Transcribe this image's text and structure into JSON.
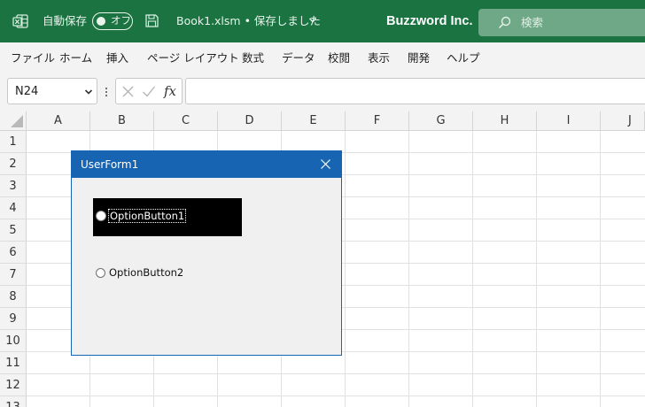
{
  "titlebar": {
    "autosave_label": "自動保存",
    "autosave_state": "オフ",
    "filename": "Book1.xlsm • 保存しました",
    "company": "Buzzword Inc.",
    "search_placeholder": "検索",
    "icons": [
      "excel-icon",
      "save-icon",
      "chevron-down-icon",
      "search-icon"
    ]
  },
  "menu": {
    "items": [
      "ファイル",
      "ホーム",
      "挿入",
      "ページ レイアウト",
      "数式",
      "データ",
      "校閲",
      "表示",
      "開発",
      "ヘルプ"
    ]
  },
  "formula_bar": {
    "name_box": "N24",
    "fx_label": "fx",
    "formula": ""
  },
  "grid": {
    "columns": [
      "A",
      "B",
      "C",
      "D",
      "E",
      "F",
      "G",
      "H",
      "I",
      "J"
    ],
    "rows": [
      "1",
      "2",
      "3",
      "4",
      "5",
      "6",
      "7",
      "8",
      "9",
      "10",
      "11",
      "12",
      "13"
    ]
  },
  "userform": {
    "title": "UserForm1",
    "option1": {
      "label": "OptionButton1",
      "selected": false,
      "focused": true,
      "background": "#000000",
      "foreground": "#ffffff"
    },
    "option2": {
      "label": "OptionButton2",
      "selected": false
    }
  },
  "colors": {
    "title_bar": "#1a7341",
    "dialog_title_bar": "#1764b2",
    "ribbon": "#f3f3f3",
    "dialog_body": "#f0f0f0"
  }
}
